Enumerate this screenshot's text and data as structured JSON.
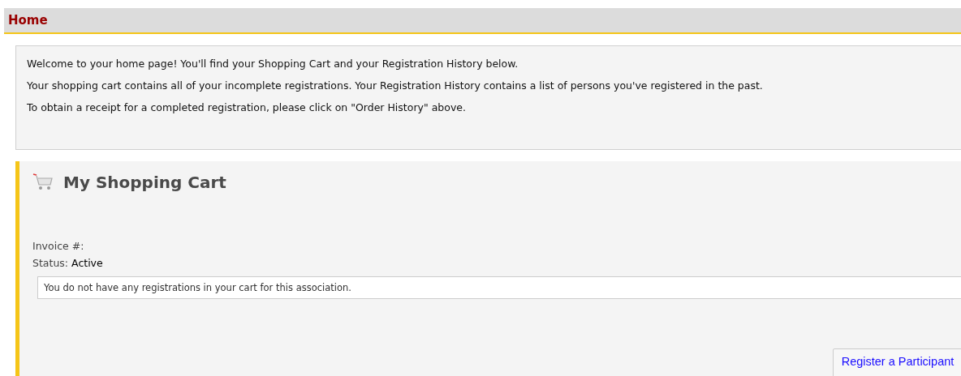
{
  "header": {
    "title": "Home"
  },
  "intro": {
    "paragraphs": [
      "Welcome to your home page! You'll find your Shopping Cart and your Registration History below.",
      "Your shopping cart contains all of your incomplete registrations. Your Registration History contains a list of persons you've registered in the past.",
      "To obtain a receipt for a completed registration, please click on \"Order History\" above."
    ]
  },
  "cart": {
    "title": "My Shopping Cart",
    "invoice_label": "Invoice #:",
    "status_label": "Status:",
    "status_value": "Active",
    "empty_message": "You do not have any registrations in your cart for this association.",
    "register_button": "Register a Participant"
  }
}
